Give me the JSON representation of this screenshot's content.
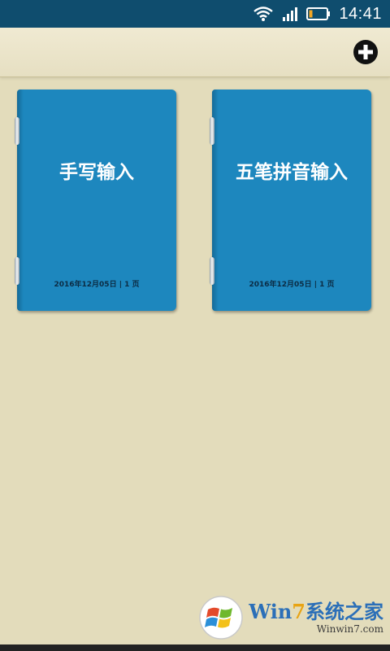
{
  "status_bar": {
    "time": "14:41",
    "icons": [
      "wifi-icon",
      "signal-icon",
      "battery-icon"
    ]
  },
  "toolbar": {
    "add_icon": "plus-circle-icon"
  },
  "notebooks": [
    {
      "title": "手写输入",
      "meta": "2016年12月05日 | 1 页"
    },
    {
      "title": "五笔拼音输入",
      "meta": "2016年12月05日 | 1 页"
    }
  ],
  "watermark": {
    "brand_w": "Wi",
    "brand_n": "n",
    "brand_seven": "7",
    "brand_rest": "系统之家",
    "url": "Winwin7.com"
  },
  "colors": {
    "statusbar": "#0f4d6e",
    "background": "#e3dcbb",
    "notebook": "#1d87be"
  }
}
